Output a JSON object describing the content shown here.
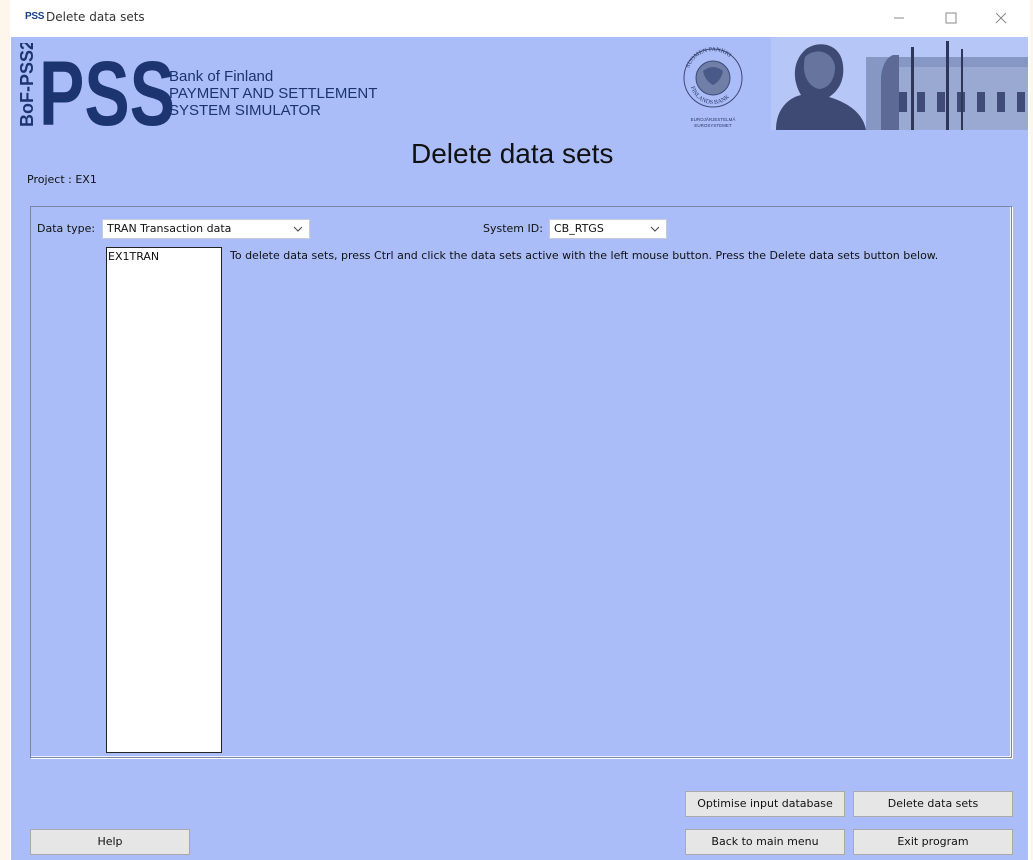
{
  "window": {
    "app_icon_text": "PSS",
    "title": "Delete data sets"
  },
  "header": {
    "logo_text": "BoF-PSS2",
    "logo_mark": "PSS",
    "bank_lines": [
      "Bank of Finland",
      "PAYMENT AND SETTLEMENT",
      "SYSTEM SIMULATOR"
    ],
    "seal_text_top": "SUOMEN PANKKI",
    "seal_text_bottom": "FINLANDS BANK",
    "seal_caption_1": "EUROJÄRJESTELMÄ",
    "seal_caption_2": "EUROSYSTEMET"
  },
  "page": {
    "title": "Delete data sets",
    "project_label": "Project : EX1"
  },
  "filters": {
    "data_type_label": "Data type:",
    "data_type_value": "TRAN Transaction data",
    "system_id_label": "System ID:",
    "system_id_value": "CB_RTGS"
  },
  "data_sets": [
    "EX1TRAN"
  ],
  "instructions": "To delete data sets, press Ctrl and click the data sets active with the left mouse button. Press the Delete data sets button below.",
  "buttons": {
    "optimise": "Optimise input database",
    "delete": "Delete data sets",
    "help": "Help",
    "back": "Back to main menu",
    "exit": "Exit program"
  },
  "colors": {
    "background": "#aabdf8",
    "logo_blue": "#1c3570"
  }
}
